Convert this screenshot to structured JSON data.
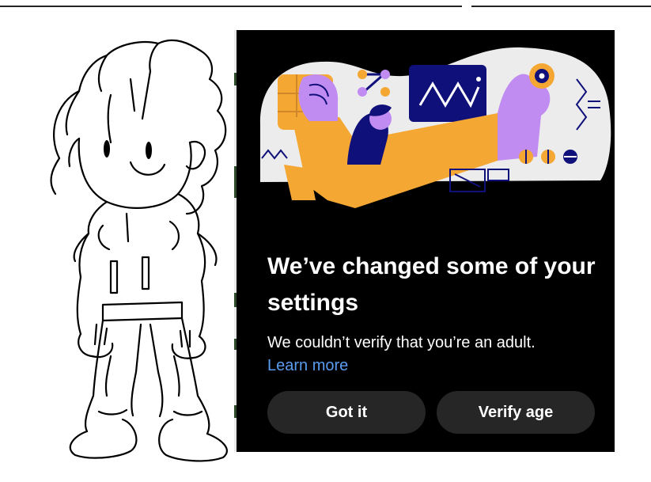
{
  "dialog": {
    "title": "We’ve changed some of your settings",
    "message": "We couldn’t verify that you’re an adult.",
    "learn_more": "Learn more",
    "buttons": {
      "got_it": "Got it",
      "verify_age": "Verify age"
    }
  },
  "colors": {
    "dialog_background": "#000000",
    "button_background": "#262626",
    "link": "#5a9cf0",
    "illustration_orange": "#f5a733",
    "illustration_purple": "#c08cf2",
    "illustration_navy": "#10107a"
  },
  "icons": [
    "sketch-character-drawing",
    "settings-illustration"
  ]
}
